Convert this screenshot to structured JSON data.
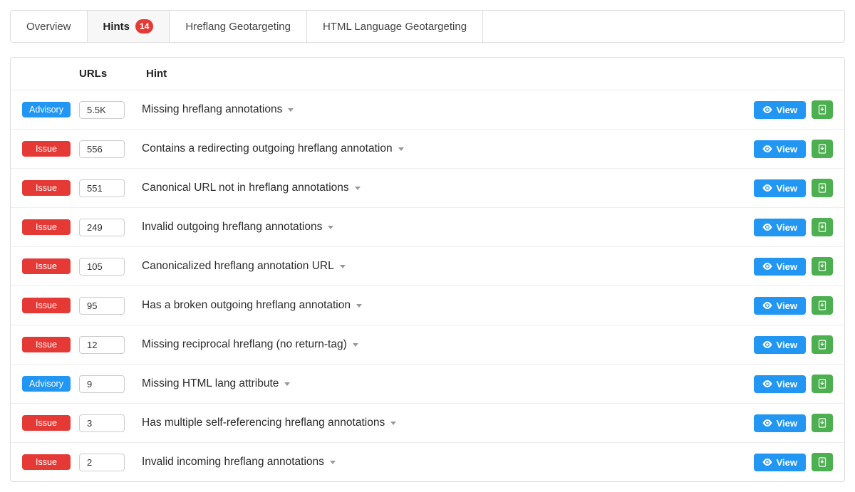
{
  "tabs": [
    {
      "label": "Overview",
      "active": false,
      "badge": null
    },
    {
      "label": "Hints",
      "active": true,
      "badge": "14"
    },
    {
      "label": "Hreflang Geotargeting",
      "active": false,
      "badge": null
    },
    {
      "label": "HTML Language Geotargeting",
      "active": false,
      "badge": null
    }
  ],
  "headers": {
    "urls": "URLs",
    "hint": "Hint"
  },
  "badge_labels": {
    "issue": "Issue",
    "advisory": "Advisory"
  },
  "view_label": "View",
  "rows": [
    {
      "type": "advisory",
      "urls": "5.5K",
      "hint": "Missing hreflang annotations"
    },
    {
      "type": "issue",
      "urls": "556",
      "hint": "Contains a redirecting outgoing hreflang annotation"
    },
    {
      "type": "issue",
      "urls": "551",
      "hint": "Canonical URL not in hreflang annotations"
    },
    {
      "type": "issue",
      "urls": "249",
      "hint": "Invalid outgoing hreflang annotations"
    },
    {
      "type": "issue",
      "urls": "105",
      "hint": "Canonicalized hreflang annotation URL"
    },
    {
      "type": "issue",
      "urls": "95",
      "hint": "Has a broken outgoing hreflang annotation"
    },
    {
      "type": "issue",
      "urls": "12",
      "hint": "Missing reciprocal hreflang (no return-tag)"
    },
    {
      "type": "advisory",
      "urls": "9",
      "hint": "Missing HTML lang attribute"
    },
    {
      "type": "issue",
      "urls": "3",
      "hint": "Has multiple self-referencing hreflang annotations"
    },
    {
      "type": "issue",
      "urls": "2",
      "hint": "Invalid incoming hreflang annotations"
    }
  ]
}
